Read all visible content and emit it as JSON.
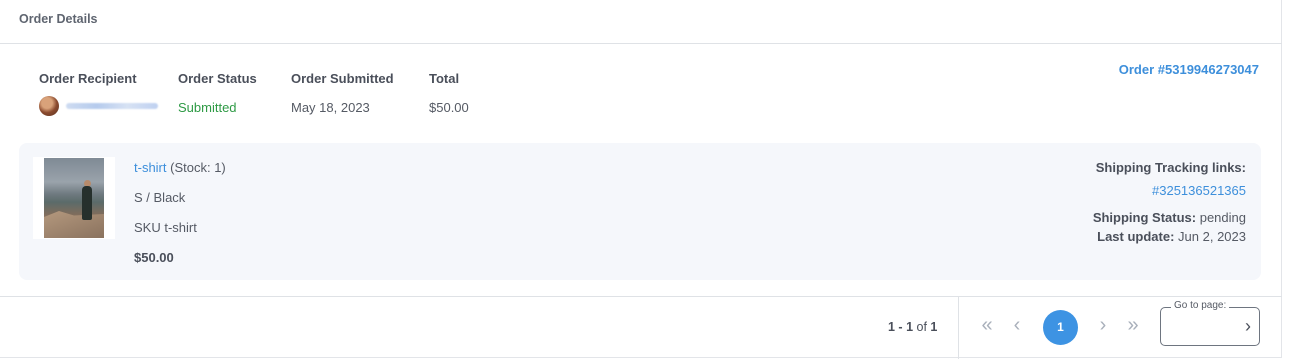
{
  "header": {
    "title": "Order Details"
  },
  "order": {
    "number": "Order #5319946273047",
    "recipient_label": "Order Recipient",
    "status_label": "Order Status",
    "status_value": "Submitted",
    "submitted_label": "Order Submitted",
    "submitted_value": "May 18, 2023",
    "total_label": "Total",
    "total_value": "$50.00"
  },
  "item": {
    "name": "t-shirt",
    "stock": "(Stock: 1)",
    "variant": "S / Black",
    "sku": "SKU t-shirt",
    "price": "$50.00"
  },
  "shipping": {
    "tracking_label": "Shipping Tracking links:",
    "tracking_link": "#325136521365",
    "status_label": "Shipping Status:",
    "status_value": "pending",
    "update_label": "Last update:",
    "update_value": "Jun 2, 2023"
  },
  "pagination": {
    "range_start": "1",
    "range_sep": " - ",
    "range_end": "1",
    "of_word": " of ",
    "total": "1",
    "current_page": "1",
    "goto_label": "Go to page:",
    "goto_value": ""
  },
  "colors": {
    "accent": "#3d93e3",
    "link": "#3d8fdb",
    "success": "#2e9a45"
  },
  "icons": {
    "first": "chevron-double-left-icon",
    "prev": "chevron-left-icon",
    "next": "chevron-right-icon",
    "last": "chevron-double-right-icon",
    "go": "chevron-right-icon"
  }
}
